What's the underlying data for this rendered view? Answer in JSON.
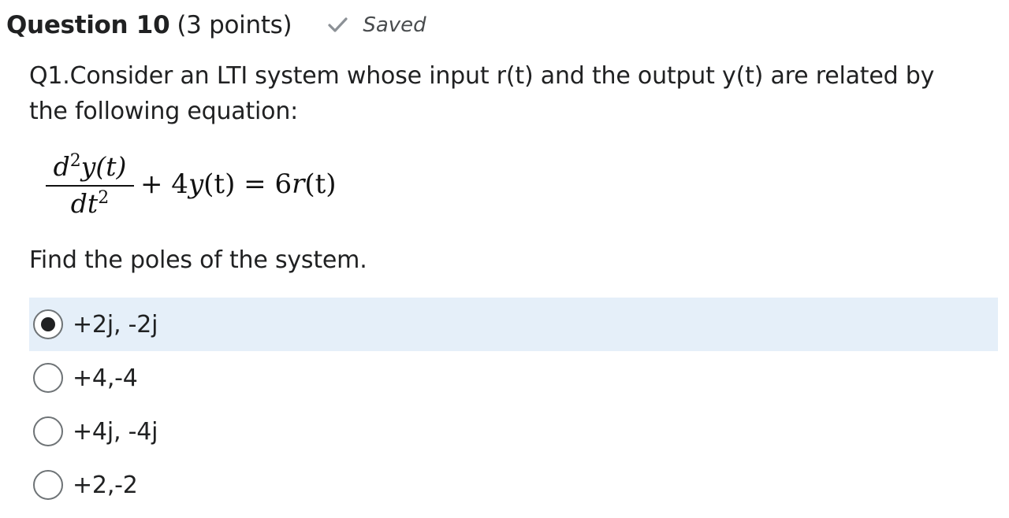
{
  "question": {
    "title": "Question 10",
    "points": "(3 points)",
    "saved_icon": "checkmark-icon",
    "saved_text": "Saved",
    "text": "Q1.Consider an LTI system whose input r(t) and the output y(t) are related by the following equation:",
    "equation": {
      "numerator_d": "d",
      "numerator_exp": "2",
      "numerator_rest": "y(t)",
      "denominator_base": "dt",
      "denominator_exp": "2",
      "rhs_plus": "+ 4",
      "rhs_y": "y",
      "rhs_yt": "(t)",
      "rhs_eq": " = 6",
      "rhs_r": "r",
      "rhs_rt": "(t)"
    },
    "prompt": "Find the poles of the system."
  },
  "options": [
    {
      "label": "+2j, -2j",
      "selected": true
    },
    {
      "label": "+4,-4",
      "selected": false
    },
    {
      "label": "+4j, -4j",
      "selected": false
    },
    {
      "label": "+2,-2",
      "selected": false
    }
  ],
  "colors": {
    "selected_background": "#e5eff9",
    "check_icon": "#8c9196",
    "text": "#202122"
  }
}
